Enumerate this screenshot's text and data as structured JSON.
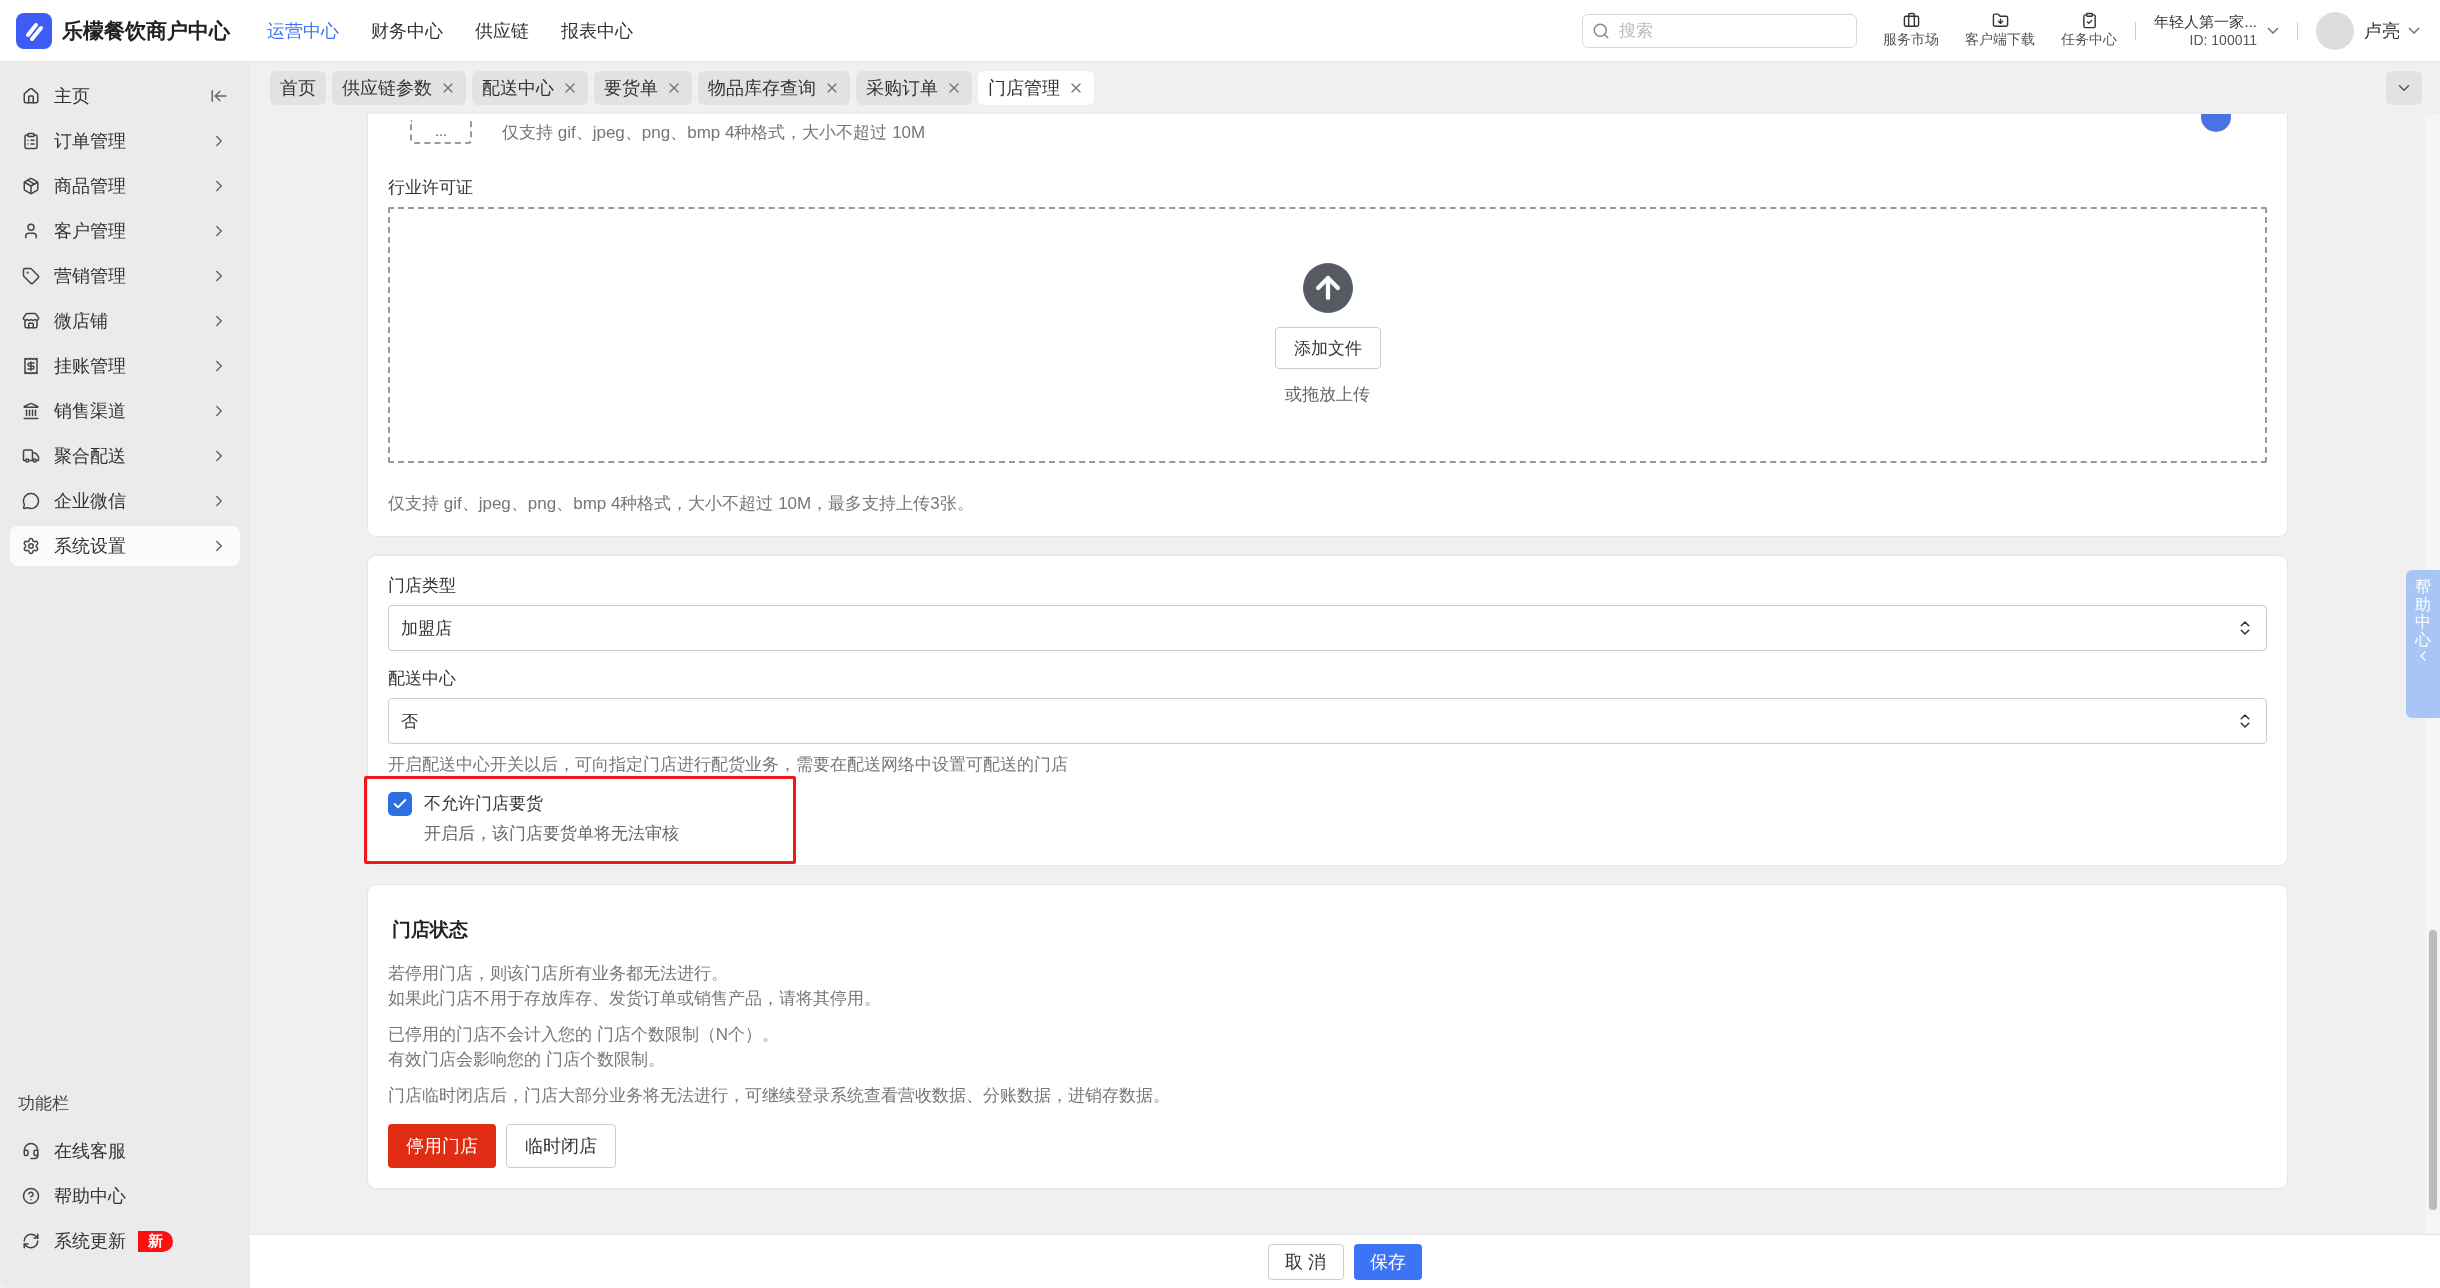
{
  "header": {
    "app_title": "乐檬餐饮商户中心",
    "nav": [
      {
        "label": "运营中心",
        "selected": true
      },
      {
        "label": "财务中心",
        "selected": false
      },
      {
        "label": "供应链",
        "selected": false
      },
      {
        "label": "报表中心",
        "selected": false
      }
    ],
    "search": {
      "placeholder": "搜索"
    },
    "tools": [
      {
        "label": "服务市场"
      },
      {
        "label": "客户端下载"
      },
      {
        "label": "任务中心"
      }
    ],
    "account": {
      "name": "年轻人第一家...",
      "id": "ID: 100011"
    },
    "user": {
      "name": "卢亮"
    }
  },
  "sidebar": {
    "items": [
      {
        "label": "主页",
        "selected": false
      },
      {
        "label": "订单管理",
        "selected": false
      },
      {
        "label": "商品管理",
        "selected": false
      },
      {
        "label": "客户管理",
        "selected": false
      },
      {
        "label": "营销管理",
        "selected": false
      },
      {
        "label": "微店铺",
        "selected": false
      },
      {
        "label": "挂账管理",
        "selected": false
      },
      {
        "label": "销售渠道",
        "selected": false
      },
      {
        "label": "聚合配送",
        "selected": false
      },
      {
        "label": "企业微信",
        "selected": false
      },
      {
        "label": "系统设置",
        "selected": true
      }
    ],
    "section_title": "功能栏",
    "function_items": [
      {
        "label": "在线客服"
      },
      {
        "label": "帮助中心"
      },
      {
        "label": "系统更新",
        "badge": "新"
      }
    ]
  },
  "tabs": [
    {
      "label": "首页",
      "selected": false,
      "closable": false
    },
    {
      "label": "供应链参数",
      "selected": false,
      "closable": true
    },
    {
      "label": "配送中心",
      "selected": false,
      "closable": true
    },
    {
      "label": "要货单",
      "selected": false,
      "closable": true
    },
    {
      "label": "物品库存查询",
      "selected": false,
      "closable": true
    },
    {
      "label": "采购订单",
      "selected": false,
      "closable": true
    },
    {
      "label": "门店管理",
      "selected": true,
      "closable": true
    }
  ],
  "upload_section": {
    "top_hint": "仅支持 gif、jpeg、png、bmp 4种格式，大小不超过 10M",
    "thumb_text": "...",
    "license": {
      "label": "行业许可证",
      "button": "添加文件",
      "drop_hint": "或拖放上传",
      "hint": "仅支持 gif、jpeg、png、bmp 4种格式，大小不超过 10M，最多支持上传3张。"
    }
  },
  "store_form": {
    "store_type": {
      "label": "门店类型",
      "value": "加盟店"
    },
    "distribution_center": {
      "label": "配送中心",
      "value": "否",
      "hint": "开启配送中心开关以后，可向指定门店进行配货业务，需要在配送网络中设置可配送的门店"
    },
    "disallow_requisition": {
      "label": "不允许门店要货",
      "description": "开启后，该门店要货单将无法审核",
      "checked": true
    }
  },
  "store_status": {
    "title": "门店状态",
    "paragraphs": [
      [
        "若停用门店，则该门店所有业务都无法进行。",
        "如果此门店不用于存放库存、发货订单或销售产品，请将其停用。"
      ],
      [
        "已停用的门店不会计入您的 门店个数限制（N个）。",
        "有效门店会影响您的 门店个数限制。"
      ],
      [
        "门店临时闭店后，门店大部分业务将无法进行，可继续登录系统查看营收数据、分账数据，进销存数据。"
      ]
    ],
    "buttons": [
      {
        "label": "停用门店",
        "kind": "danger"
      },
      {
        "label": "临时闭店",
        "kind": "default"
      }
    ]
  },
  "footer": {
    "buttons": [
      {
        "label": "取 消",
        "kind": "default"
      },
      {
        "label": "保存",
        "kind": "primary"
      }
    ]
  },
  "help_tab": {
    "label": "帮助中心"
  }
}
